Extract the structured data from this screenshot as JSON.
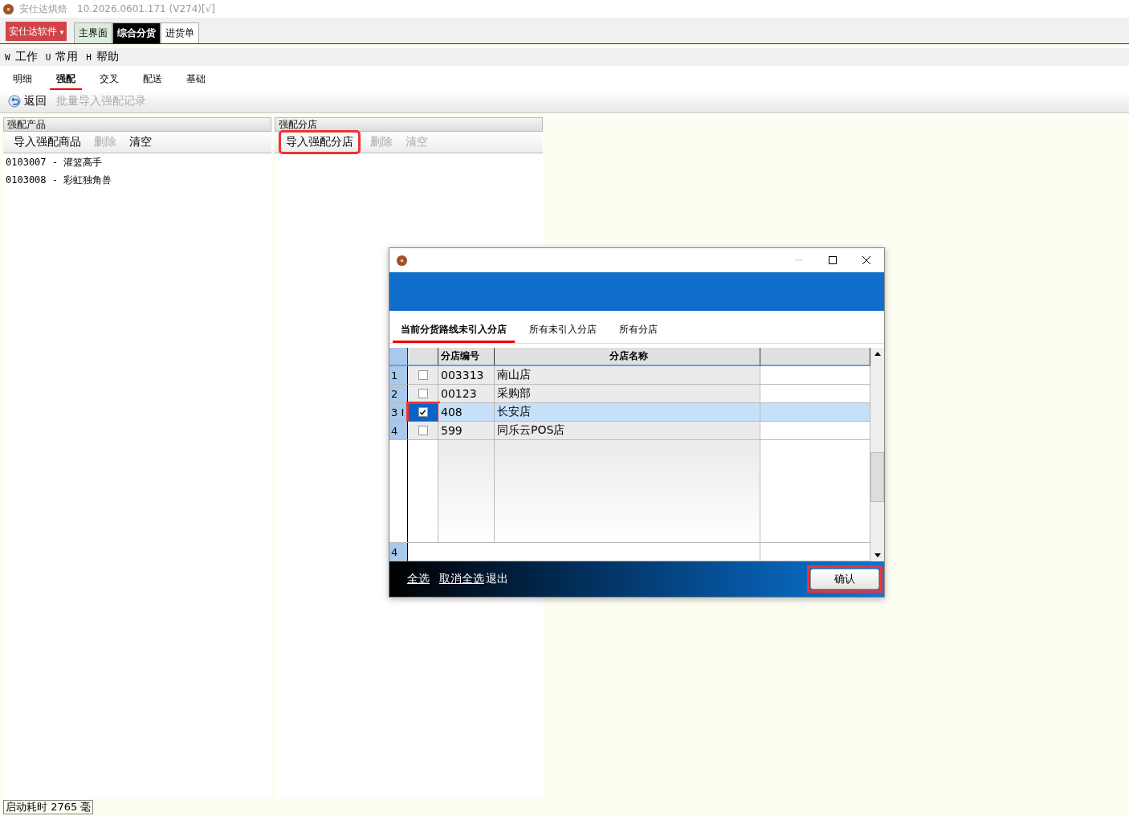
{
  "app": {
    "title": "安仕达烘焙",
    "version": "10.2026.0601.171 (V274)[√]"
  },
  "brand_button": {
    "label": "安仕达软件",
    "caret": "▾"
  },
  "module_tabs": [
    {
      "label": "主界面",
      "selected": false,
      "kind": "home"
    },
    {
      "label": "综合分货",
      "selected": true,
      "kind": "normal"
    },
    {
      "label": "进货单",
      "selected": false,
      "kind": "normal"
    }
  ],
  "menu": [
    {
      "key": "W",
      "label": "工作"
    },
    {
      "key": "U",
      "label": "常用"
    },
    {
      "key": "H",
      "label": "帮助"
    }
  ],
  "sub_tabs": [
    {
      "label": "明细",
      "selected": false
    },
    {
      "label": "强配",
      "selected": true
    },
    {
      "label": "交叉",
      "selected": false
    },
    {
      "label": "配送",
      "selected": false
    },
    {
      "label": "基础",
      "selected": false
    }
  ],
  "toolbar": [
    {
      "label": "返回",
      "disabled": false,
      "icon": true
    },
    {
      "label": "批量导入强配记录",
      "disabled": true,
      "icon": false
    }
  ],
  "panels": [
    {
      "title": "强配产品",
      "actions": [
        {
          "label": "导入强配商品",
          "disabled": false,
          "highlighted": false
        },
        {
          "label": "删除",
          "disabled": true,
          "highlighted": false
        },
        {
          "label": "清空",
          "disabled": false,
          "highlighted": false
        }
      ],
      "items": [
        "0103007 - 灌篮高手",
        "0103008 - 彩虹独角兽"
      ]
    },
    {
      "title": "强配分店",
      "actions": [
        {
          "label": "导入强配分店",
          "disabled": false,
          "highlighted": true
        },
        {
          "label": "删除",
          "disabled": true,
          "highlighted": false
        },
        {
          "label": "清空",
          "disabled": true,
          "highlighted": false
        }
      ]
    }
  ],
  "dialog": {
    "tabs": [
      {
        "label": "当前分货路线未引入分店",
        "selected": true
      },
      {
        "label": "所有未引入分店",
        "selected": false
      },
      {
        "label": "所有分店",
        "selected": false
      }
    ],
    "columns": [
      "分店编号",
      "分店名称"
    ],
    "rows": [
      {
        "index": "1",
        "checked": false,
        "selected": false,
        "highlighted": false,
        "code": "003313",
        "name": "南山店"
      },
      {
        "index": "2",
        "checked": false,
        "selected": false,
        "highlighted": false,
        "code": "00123",
        "name": "采购部"
      },
      {
        "index": "3 I",
        "checked": true,
        "selected": true,
        "highlighted": true,
        "code": "408",
        "name": "长安店"
      },
      {
        "index": "4",
        "checked": false,
        "selected": false,
        "highlighted": false,
        "code": "599",
        "name": "同乐云POS店"
      }
    ],
    "footer_count": "4",
    "links": [
      "全选",
      "取消全选"
    ],
    "exit": "退出",
    "confirm": {
      "label": "确认",
      "highlighted": true
    }
  },
  "status_bar": "启动耗时 2765 毫"
}
